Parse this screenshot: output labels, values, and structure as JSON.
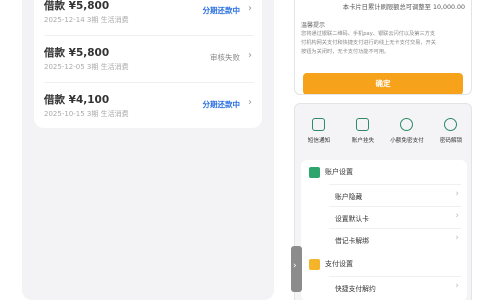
{
  "loans": [
    {
      "amount": "借款 ¥5,800",
      "meta": "2025-12-14 3期    生活消费",
      "status": "分期还款中",
      "status_type": "blue"
    },
    {
      "amount": "借款 ¥5,800",
      "meta": "2025-12-05 3期    生活消费",
      "status": "审核失败",
      "status_type": "gray"
    },
    {
      "amount": "借款 ¥4,100",
      "meta": "2025-10-15 3期    生活消费",
      "status": "分期还款中",
      "status_type": "blue"
    }
  ],
  "dialog": {
    "limit_text": "本卡片日累计刷限额总可调整至 10,000.00",
    "warm_title": "温馨提示",
    "warm_lines": [
      "您将通过银联二维码、手机pay、银联云闪付以及第三方支",
      "付机构网关支付和快捷支付进行的线上无卡支付交易，开关",
      "按钮为关闭时，无卡支付功能不可用。"
    ],
    "confirm_label": "确定"
  },
  "quick_actions": [
    {
      "label": "短信通知",
      "icon": "sms-icon"
    },
    {
      "label": "账户挂失",
      "icon": "report-loss-icon"
    },
    {
      "label": "小额免密支付",
      "icon": "small-payment-icon"
    },
    {
      "label": "密码解锁",
      "icon": "password-unlock-icon"
    }
  ],
  "settings": {
    "account_section": "账户设置",
    "account_items": [
      "账户隐藏",
      "设置默认卡",
      "借记卡解绑"
    ],
    "payment_section": "支付设置",
    "payment_items": [
      "快捷支付解约"
    ]
  },
  "side_tab_glyph": "›"
}
